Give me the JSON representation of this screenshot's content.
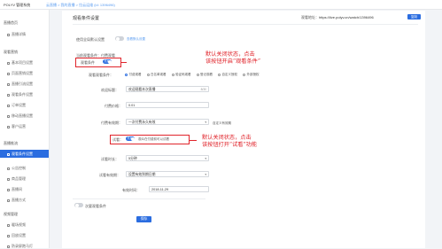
{
  "topbar": {
    "brand": "POLYV 管理系统",
    "breadcrumb": "云直播 > 我的直播 > 拉云运维 (id: 1396496)"
  },
  "sidebar": {
    "sections": [
      {
        "label": "直播首页",
        "items": [
          {
            "label": "直播详情"
          }
        ]
      },
      {
        "label": "观看营销",
        "items": [
          {
            "label": "基本项目设置"
          },
          {
            "label": "页面营销设置"
          },
          {
            "label": "直播引流设置"
          },
          {
            "label": "观看条件设置"
          },
          {
            "label": "订单设置"
          },
          {
            "label": "移动直播设置"
          },
          {
            "label": "客户运营"
          }
        ]
      },
      {
        "label": "直播推流",
        "items": [
          {
            "label": "观看条件设置",
            "active": true
          },
          {
            "label": "公告控制"
          },
          {
            "label": "商品管理"
          },
          {
            "label": "直播间"
          },
          {
            "label": "直播方式"
          }
        ]
      },
      {
        "label": "视频管理",
        "items": [
          {
            "label": "暖场视频"
          },
          {
            "label": "回放设置"
          },
          {
            "label": "防录屏跑马灯"
          }
        ]
      }
    ]
  },
  "main": {
    "title": "观看条件设置",
    "link_label": "观看地址：",
    "link_value": "https://live.polyv.cn/watch/1396496",
    "copy_label": "复制",
    "global_label": "使用全局默认设置",
    "global_hint": "查看默认设置",
    "auth_intro": "当前观看条件：付费观看",
    "main_cond_label": "观看条件",
    "main_cond_toggle": "开启",
    "type_label": "观看观看条件：",
    "type_options": [
      {
        "label": "付费观看",
        "selected": true
      },
      {
        "label": "白名单观看",
        "selected": false
      },
      {
        "label": "验证码观看",
        "selected": false
      },
      {
        "label": "登记观看",
        "selected": false
      },
      {
        "label": "自定义授权",
        "selected": false
      },
      {
        "label": "外部授权",
        "selected": false
      }
    ],
    "welcome_label": "欢迎标题：",
    "welcome_value": "欢迎观看本次直播",
    "welcome_count": "8/30",
    "price_label": "付费价格：",
    "price_value": "0.01",
    "validity_label": "付费有效期：",
    "validity_value": "一次付费永久有效",
    "validity_hint": "自定义有效期",
    "trial_label": "试看：",
    "trial_toggle": "开启",
    "trial_hint": "观众在付费前可以试看",
    "trial_duration_label": "试看时长：",
    "trial_duration_value": "5分钟",
    "trial_validity_label": "试看有效期：",
    "trial_validity_value": "设置有效到期日期",
    "expire_label": "有效时间：",
    "expire_value": "2018-11-29",
    "secondary_label": "次要观看条件",
    "save_label": "保存"
  },
  "annotations": {
    "first_line1": "默认关闭状态，点击",
    "first_line2": "该按钮开启“观看条件”",
    "second_line1": "默认关闭状态，点击",
    "second_line2": "该按钮打开“试看”功能",
    "color": "#e0242b"
  },
  "colors": {
    "accent": "#2b6de0",
    "link": "#5a9cf0"
  }
}
